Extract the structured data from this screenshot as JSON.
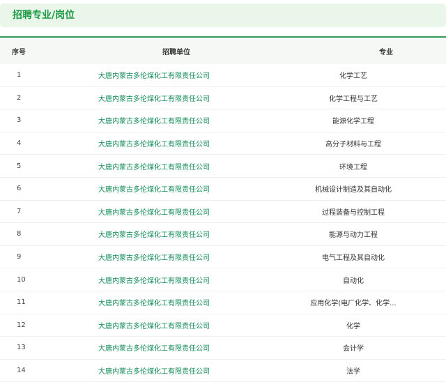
{
  "section": {
    "title": "招聘专业/岗位"
  },
  "table": {
    "headers": {
      "index": "序号",
      "company": "招聘单位",
      "major": "专业"
    },
    "rows": [
      {
        "index": "1",
        "company": "大唐内蒙古多伦煤化工有限责任公司",
        "major": "化学工艺"
      },
      {
        "index": "2",
        "company": "大唐内蒙古多伦煤化工有限责任公司",
        "major": "化学工程与工艺"
      },
      {
        "index": "3",
        "company": "大唐内蒙古多伦煤化工有限责任公司",
        "major": "能源化学工程"
      },
      {
        "index": "4",
        "company": "大唐内蒙古多伦煤化工有限责任公司",
        "major": "高分子材料与工程"
      },
      {
        "index": "5",
        "company": "大唐内蒙古多伦煤化工有限责任公司",
        "major": "环境工程"
      },
      {
        "index": "6",
        "company": "大唐内蒙古多伦煤化工有限责任公司",
        "major": "机械设计制造及其自动化"
      },
      {
        "index": "7",
        "company": "大唐内蒙古多伦煤化工有限责任公司",
        "major": "过程装备与控制工程"
      },
      {
        "index": "8",
        "company": "大唐内蒙古多伦煤化工有限责任公司",
        "major": "能源与动力工程"
      },
      {
        "index": "9",
        "company": "大唐内蒙古多伦煤化工有限责任公司",
        "major": "电气工程及其自动化"
      },
      {
        "index": "10",
        "company": "大唐内蒙古多伦煤化工有限责任公司",
        "major": "自动化"
      },
      {
        "index": "11",
        "company": "大唐内蒙古多伦煤化工有限责任公司",
        "major": "应用化学(电厂化学、化学..."
      },
      {
        "index": "12",
        "company": "大唐内蒙古多伦煤化工有限责任公司",
        "major": "化学"
      },
      {
        "index": "13",
        "company": "大唐内蒙古多伦煤化工有限责任公司",
        "major": "会计学"
      },
      {
        "index": "14",
        "company": "大唐内蒙古多伦煤化工有限责任公司",
        "major": "法学"
      }
    ]
  }
}
